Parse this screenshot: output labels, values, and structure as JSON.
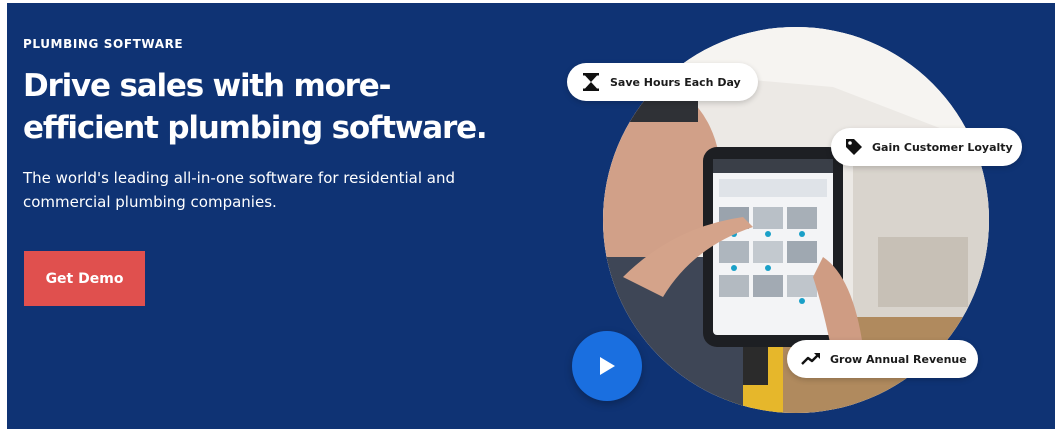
{
  "hero": {
    "eyebrow": "PLUMBING SOFTWARE",
    "headline_line1": "Drive sales with more-",
    "headline_line2": "efficient plumbing software.",
    "subhead_line1": "The world's leading all-in-one software for residential and",
    "subhead_line2": "commercial plumbing companies.",
    "cta_label": "Get Demo"
  },
  "features": [
    {
      "label": "Save Hours Each Day",
      "icon": "hourglass-icon"
    },
    {
      "label": "Gain Customer Loyalty",
      "icon": "tag-icon"
    },
    {
      "label": "Grow Annual Revenue",
      "icon": "trend-up-icon"
    }
  ],
  "media": {
    "play_icon": "play-icon"
  },
  "colors": {
    "background": "#0f3374",
    "cta": "#e0504e",
    "play": "#1a6fe0",
    "pill": "#ffffff"
  }
}
